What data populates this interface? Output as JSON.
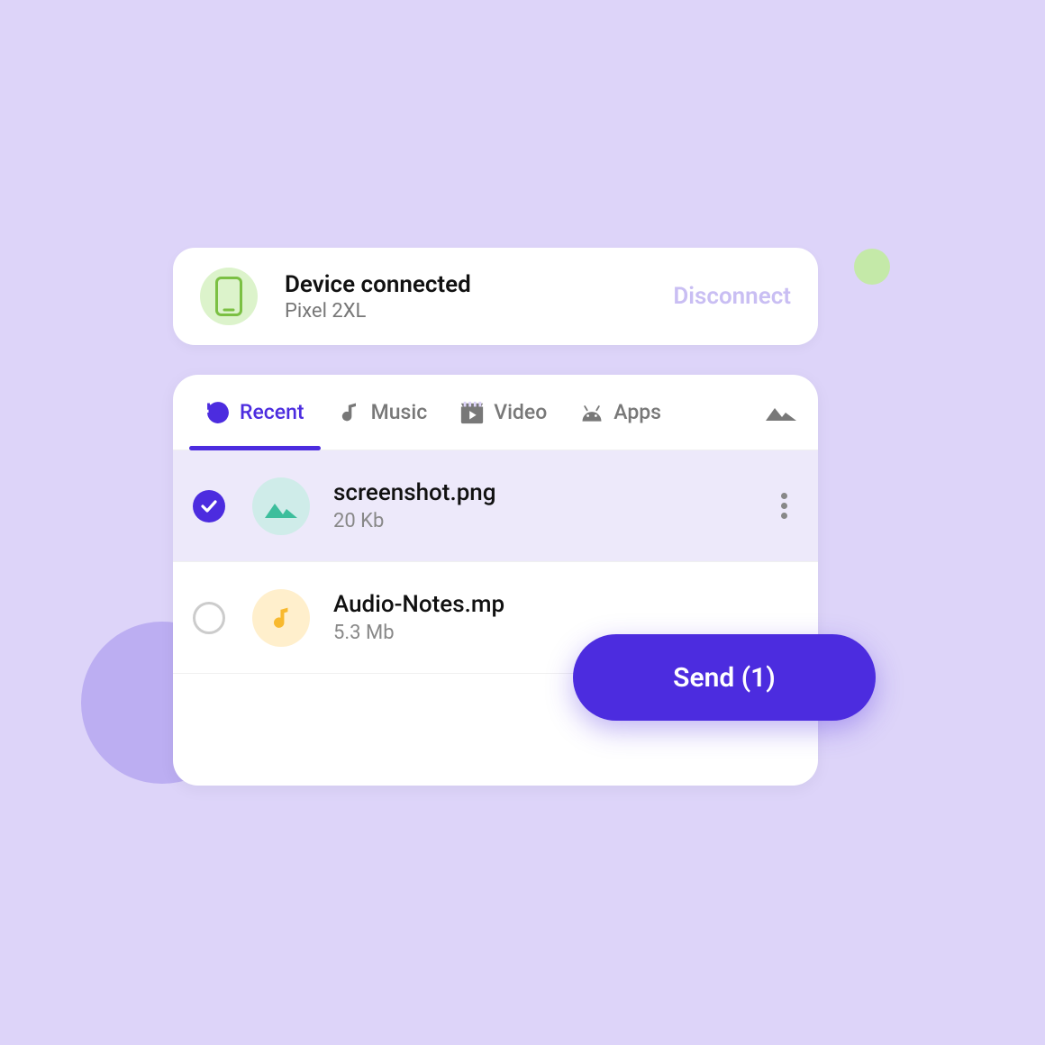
{
  "connection": {
    "title": "Device connected",
    "device": "Pixel 2XL",
    "action": "Disconnect"
  },
  "tabs": [
    {
      "label": "Recent",
      "active": true
    },
    {
      "label": "Music",
      "active": false
    },
    {
      "label": "Video",
      "active": false
    },
    {
      "label": "Apps",
      "active": false
    }
  ],
  "files": [
    {
      "name": "screenshot.png",
      "size": "20 Kb",
      "type": "image",
      "selected": true
    },
    {
      "name": "Audio-Notes.mp",
      "size": "5.3 Mb",
      "type": "audio",
      "selected": false
    }
  ],
  "send_label": "Send (1)"
}
